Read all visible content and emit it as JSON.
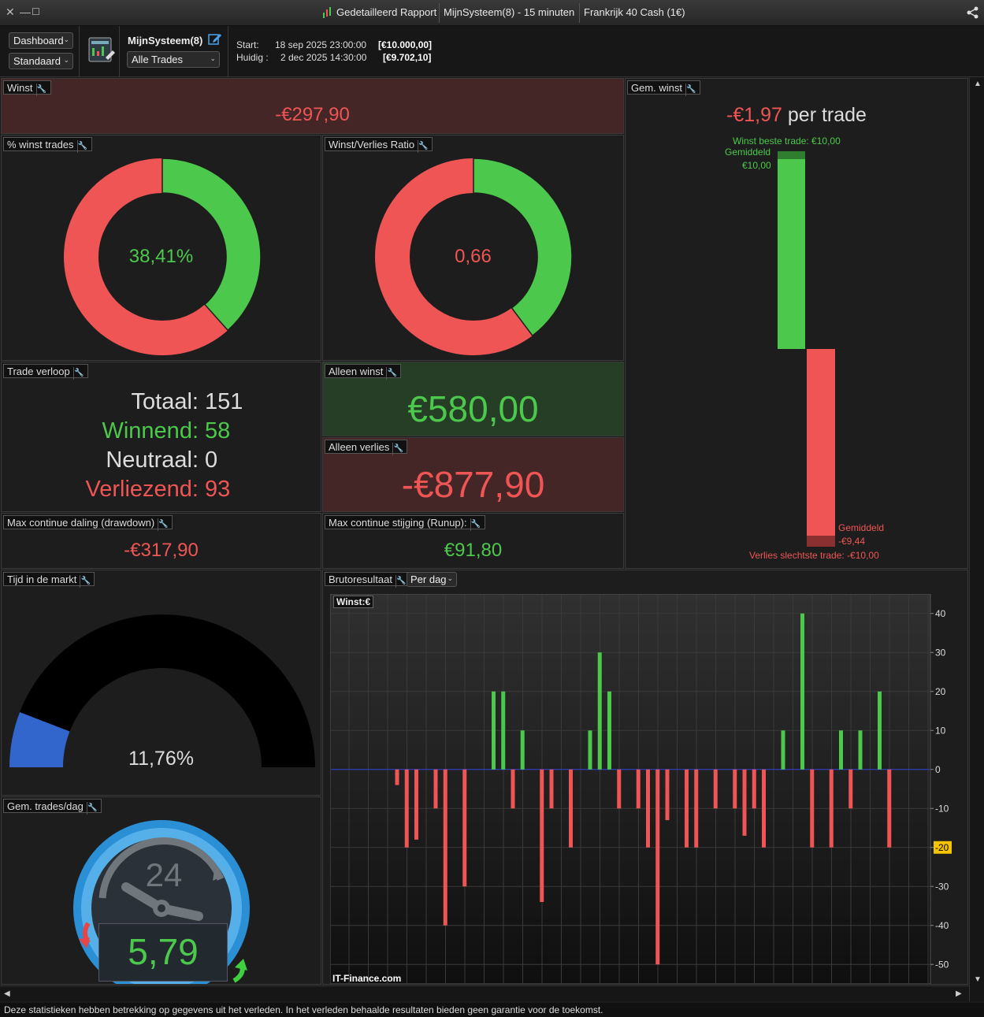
{
  "window": {
    "title": "Gedetailleerd Rapport",
    "system": "MijnSysteem(8) - 15 minuten",
    "instrument": "Frankrijk 40 Cash (1€)"
  },
  "toolbar": {
    "view_select": "Dashboard",
    "layout_select": "Standaard",
    "system_name": "MijnSysteem(8)",
    "trades_filter": "Alle Trades",
    "start_label": "Start:",
    "start_date": "18 sep 2025 23:00:00",
    "start_capital": "[€10.000,00]",
    "current_label": "Huidig :",
    "current_date": "2 dec 2025 14:30:00",
    "current_capital": "[€9.702,10]"
  },
  "panels": {
    "winst": {
      "title": "Winst",
      "value": "-€297,90"
    },
    "pct_winst": {
      "title": "% winst trades",
      "value": "38,41%",
      "fraction": 0.3841
    },
    "ratio": {
      "title": "Winst/Verlies Ratio",
      "value": "0,66",
      "fraction": 0.3978
    },
    "gem_winst": {
      "title": "Gem. winst",
      "value": "-€1,97",
      "unit": "per trade",
      "best_label": "Winst beste trade: €10,00",
      "avg_win_label": "Gemiddeld",
      "avg_win_value": "€10,00",
      "avg_loss_label": "Gemiddeld",
      "avg_loss_value": "-€9,44",
      "worst_label": "Verlies slechtste trade: -€10,00"
    },
    "verloop": {
      "title": "Trade verloop",
      "total_label": "Totaal:",
      "total": "151",
      "win_label": "Winnend:",
      "win": "58",
      "neutral_label": "Neutraal:",
      "neutral": "0",
      "loss_label": "Verliezend:",
      "loss": "93"
    },
    "alleen_winst": {
      "title": "Alleen winst",
      "value": "€580,00"
    },
    "alleen_verlies": {
      "title": "Alleen verlies",
      "value": "-€877,90"
    },
    "drawdown": {
      "title": "Max continue daling (drawdown)",
      "value": "-€317,90"
    },
    "runup": {
      "title": "Max continue stijging (Runup):",
      "value": "€91,80"
    },
    "tijd": {
      "title": "Tijd in de markt",
      "value": "11,76%",
      "fraction": 0.1176
    },
    "trades_dag": {
      "title": "Gem. trades/dag",
      "value": "5,79",
      "dial_label": "24"
    },
    "bruto": {
      "title": "Brutoresultaat",
      "period": "Per dag",
      "legend": "Winst:€",
      "watermark": "IT-Finance.com"
    }
  },
  "colors": {
    "green": "#4cc94c",
    "red": "#f05555",
    "blue": "#3366cc",
    "highlight": "#f5c400"
  },
  "chart_data": {
    "type": "bar",
    "ylim": [
      -55,
      45
    ],
    "yticks": [
      40,
      30,
      20,
      10,
      0,
      -10,
      -20,
      -30,
      -40,
      -50
    ],
    "highlight_tick": -20,
    "values": [
      0,
      0,
      0,
      0,
      0,
      0,
      -4,
      -20,
      -18,
      0,
      -10,
      -40,
      0,
      -30,
      0,
      0,
      20,
      20,
      -10,
      10,
      0,
      -34,
      -10,
      0,
      -20,
      0,
      10,
      30,
      20,
      -10,
      0,
      -10,
      -20,
      -50,
      -13,
      0,
      -20,
      -20,
      0,
      -10,
      0,
      -10,
      -17,
      -10,
      -20,
      0,
      10,
      0,
      40,
      -20,
      0,
      -20,
      10,
      -10,
      10,
      0,
      20,
      -20,
      0,
      0,
      0,
      0
    ]
  },
  "status": {
    "disclaimer": "Deze statistieken hebben betrekking op gegevens uit het verleden. In het verleden behaalde resultaten bieden geen garantie voor de toekomst."
  }
}
